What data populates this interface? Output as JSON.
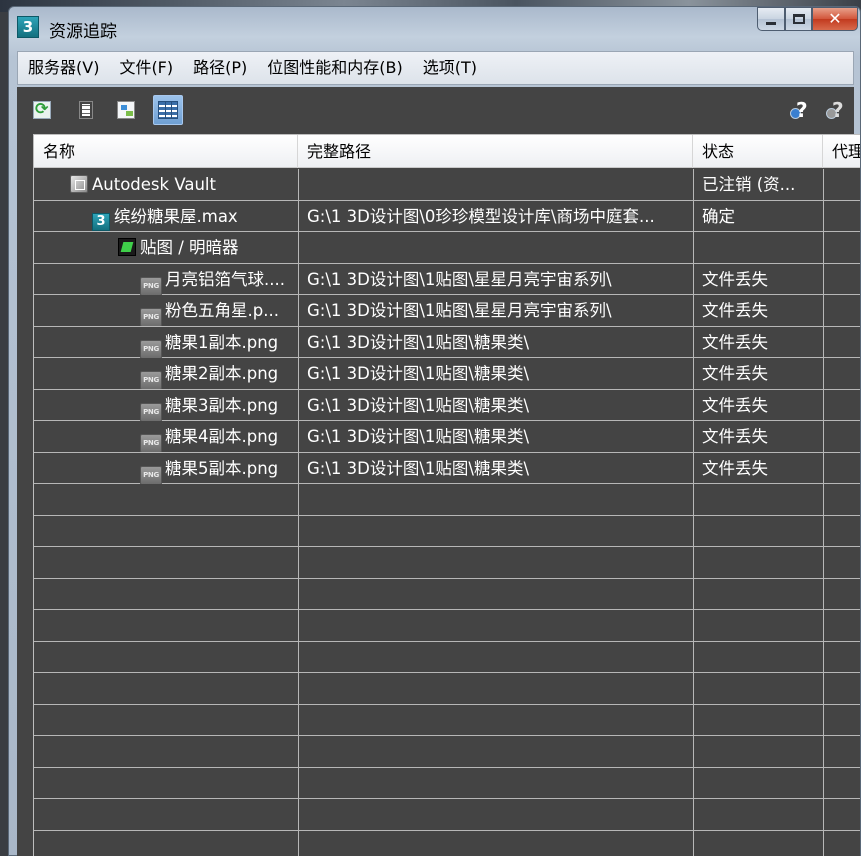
{
  "window": {
    "title": "资源追踪",
    "app_icon_label": "3"
  },
  "menu": [
    "服务器(V)",
    "文件(F)",
    "路径(P)",
    "位图性能和内存(B)",
    "选项(T)"
  ],
  "toolbar": {
    "buttons": [
      "refresh-icon",
      "list-view-icon",
      "tree-view-icon",
      "table-view-icon"
    ],
    "help_buttons": [
      "help-icon",
      "help-disabled-icon"
    ]
  },
  "table": {
    "columns": [
      "名称",
      "完整路径",
      "状态",
      "代理"
    ],
    "rows": [
      {
        "indent": 1,
        "icon": "vault",
        "name": "Autodesk Vault",
        "path": "",
        "status": "已注销 (资..."
      },
      {
        "indent": 2,
        "icon": "max",
        "name": "缤纷糖果屋.max",
        "path": "G:\\1 3D设计图\\0珍珍模型设计库\\商场中庭套...",
        "status": "确定"
      },
      {
        "indent": 3,
        "icon": "map",
        "name": "贴图 / 明暗器",
        "path": "",
        "status": ""
      },
      {
        "indent": 4,
        "icon": "png",
        "name": "月亮铝箔气球....",
        "path": "G:\\1 3D设计图\\1贴图\\星星月亮宇宙系列\\",
        "status": "文件丢失"
      },
      {
        "indent": 4,
        "icon": "png",
        "name": "粉色五角星.p...",
        "path": "G:\\1 3D设计图\\1贴图\\星星月亮宇宙系列\\",
        "status": "文件丢失"
      },
      {
        "indent": 4,
        "icon": "png",
        "name": "糖果1副本.png",
        "path": "G:\\1 3D设计图\\1贴图\\糖果类\\",
        "status": "文件丢失"
      },
      {
        "indent": 4,
        "icon": "png",
        "name": "糖果2副本.png",
        "path": "G:\\1 3D设计图\\1贴图\\糖果类\\",
        "status": "文件丢失"
      },
      {
        "indent": 4,
        "icon": "png",
        "name": "糖果3副本.png",
        "path": "G:\\1 3D设计图\\1贴图\\糖果类\\",
        "status": "文件丢失"
      },
      {
        "indent": 4,
        "icon": "png",
        "name": "糖果4副本.png",
        "path": "G:\\1 3D设计图\\1贴图\\糖果类\\",
        "status": "文件丢失"
      },
      {
        "indent": 4,
        "icon": "png",
        "name": "糖果5副本.png",
        "path": "G:\\1 3D设计图\\1贴图\\糖果类\\",
        "status": "文件丢失"
      }
    ],
    "empty_rows": 12
  },
  "colors": {
    "grid_bg": "#444444",
    "row_text": "#ffffff",
    "header_bg": "#ffffff"
  }
}
